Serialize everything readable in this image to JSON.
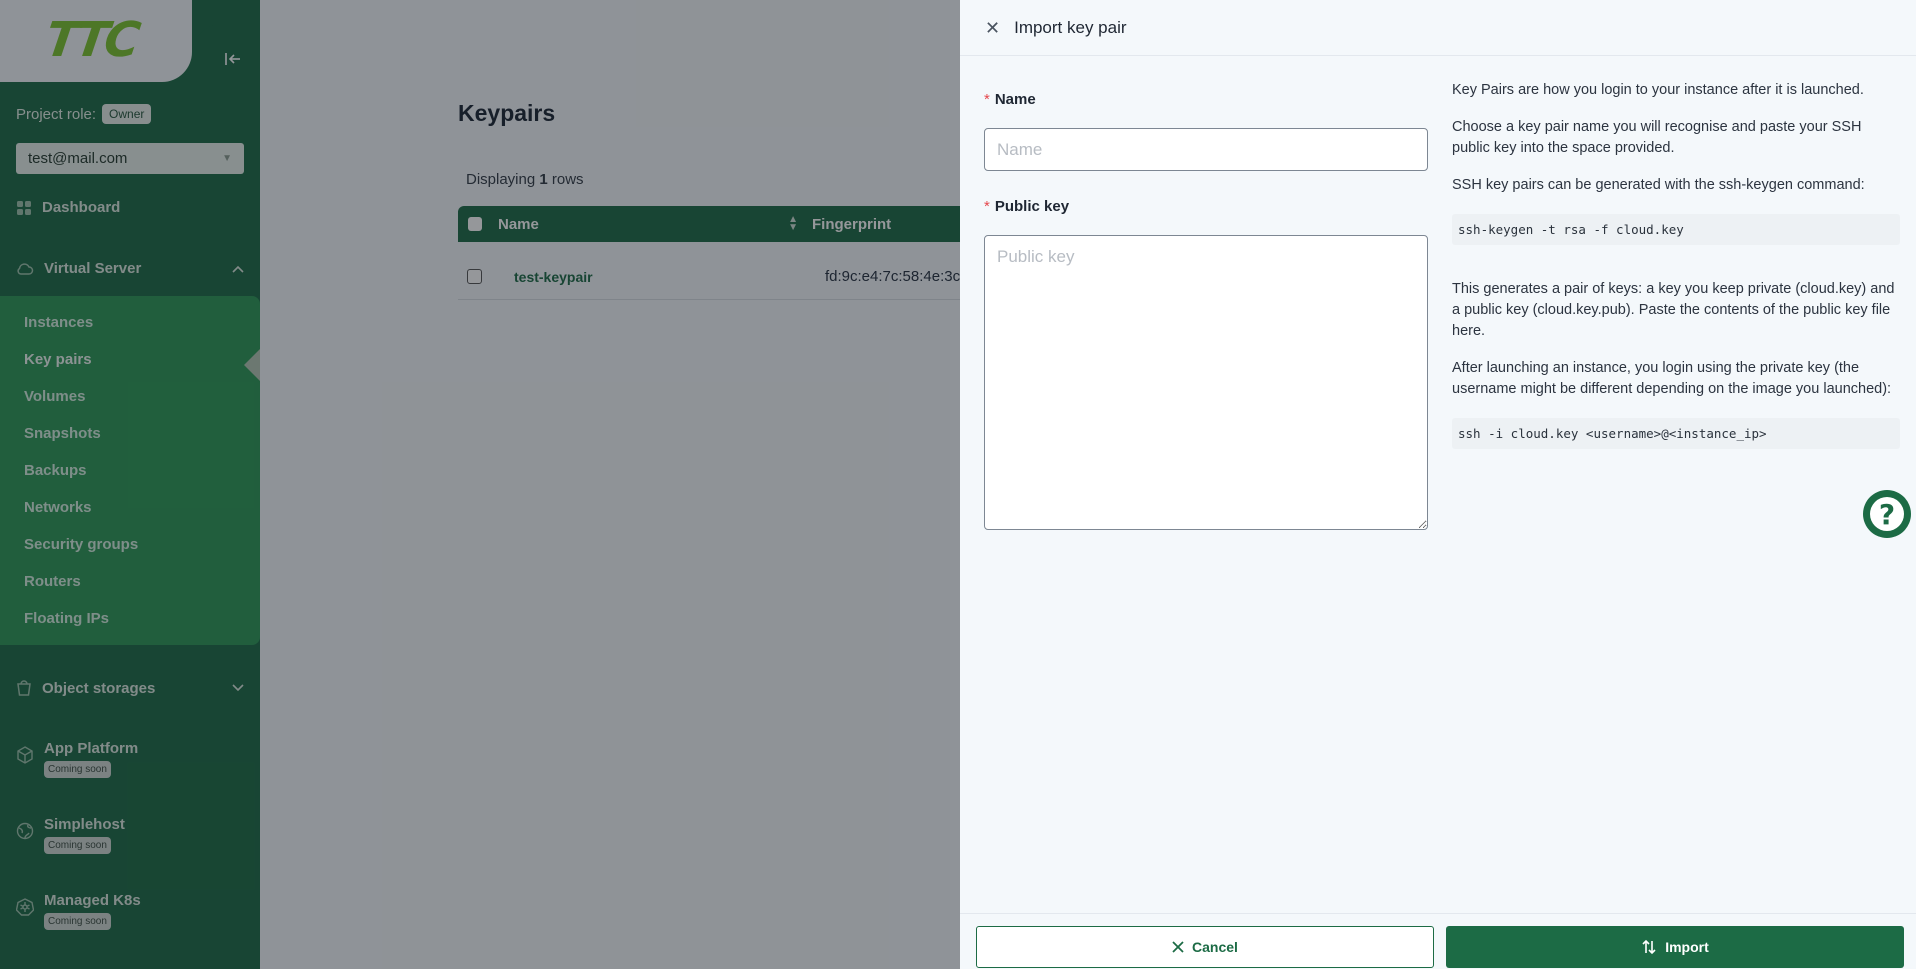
{
  "sidebar": {
    "logo_text": "TTC",
    "project_role_label": "Project role:",
    "project_role_badge": "Owner",
    "account": "test@mail.com",
    "nav": {
      "dashboard": "Dashboard",
      "virtual_server": "Virtual Server",
      "object_storages": "Object storages",
      "app_platform": "App Platform",
      "simplehost": "Simplehost",
      "managed_k8s": "Managed K8s",
      "coming_soon": "Coming soon"
    },
    "virtual_server_items": [
      "Instances",
      "Key pairs",
      "Volumes",
      "Snapshots",
      "Backups",
      "Networks",
      "Security groups",
      "Routers",
      "Floating IPs"
    ],
    "active_item": "Key pairs"
  },
  "main": {
    "title": "Keypairs",
    "displaying_prefix": "Displaying",
    "displaying_count": "1",
    "displaying_suffix": "rows",
    "columns": [
      "Name",
      "Fingerprint"
    ],
    "rows": [
      {
        "name": "test-keypair",
        "fingerprint": "fd:9c:e4:7c:58:4e:3c"
      }
    ]
  },
  "drawer": {
    "title": "Import key pair",
    "name_label": "Name",
    "name_placeholder": "Name",
    "name_value": "",
    "public_key_label": "Public key",
    "public_key_placeholder": "Public key",
    "public_key_value": "",
    "required_mark": "*",
    "help": {
      "p1": "Key Pairs are how you login to your instance after it is launched.",
      "p2": "Choose a key pair name you will recognise and paste your SSH public key into the space provided.",
      "p3": "SSH key pairs can be generated with the ssh-keygen command:",
      "code1": "ssh-keygen -t rsa -f cloud.key",
      "p4": "This generates a pair of keys: a key you keep private (cloud.key) and a public key (cloud.key.pub). Paste the contents of the public key file here.",
      "p5": "After launching an instance, you login using the private key (the username might be different depending on the image you launched):",
      "code2": "ssh -i cloud.key <username>@<instance_ip>"
    },
    "cancel_label": "Cancel",
    "import_label": "Import",
    "help_fab": "?"
  },
  "colors": {
    "brand_green": "#1c6b45",
    "submenu_green": "#2c9857",
    "logo_green": "#7dc52e",
    "required_red": "#e5484d"
  }
}
